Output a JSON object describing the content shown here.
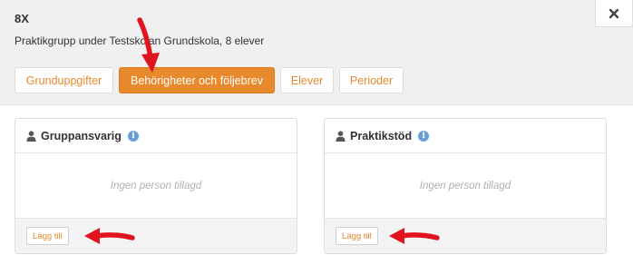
{
  "header": {
    "title": "8X",
    "subtitle": "Praktikgrupp under Testskolan Grundskola, 8 elever"
  },
  "tabs": [
    {
      "label": "Grunduppgifter",
      "active": false
    },
    {
      "label": "Behörigheter och följebrev",
      "active": true
    },
    {
      "label": "Elever",
      "active": false
    },
    {
      "label": "Perioder",
      "active": false
    }
  ],
  "panels": [
    {
      "title": "Gruppansvarig",
      "empty_text": "Ingen person tillagd",
      "add_label": "Lägg till"
    },
    {
      "title": "Praktikstöd",
      "empty_text": "Ingen person tillagd",
      "add_label": "Lägg till"
    }
  ],
  "icons": {
    "close": "close-icon",
    "user": "user-icon",
    "info": "info-icon",
    "annotation_arrow": "red-arrow-icon"
  },
  "colors": {
    "accent": "#e8892c",
    "info": "#6a9fd6",
    "annotation": "#e0141e"
  }
}
